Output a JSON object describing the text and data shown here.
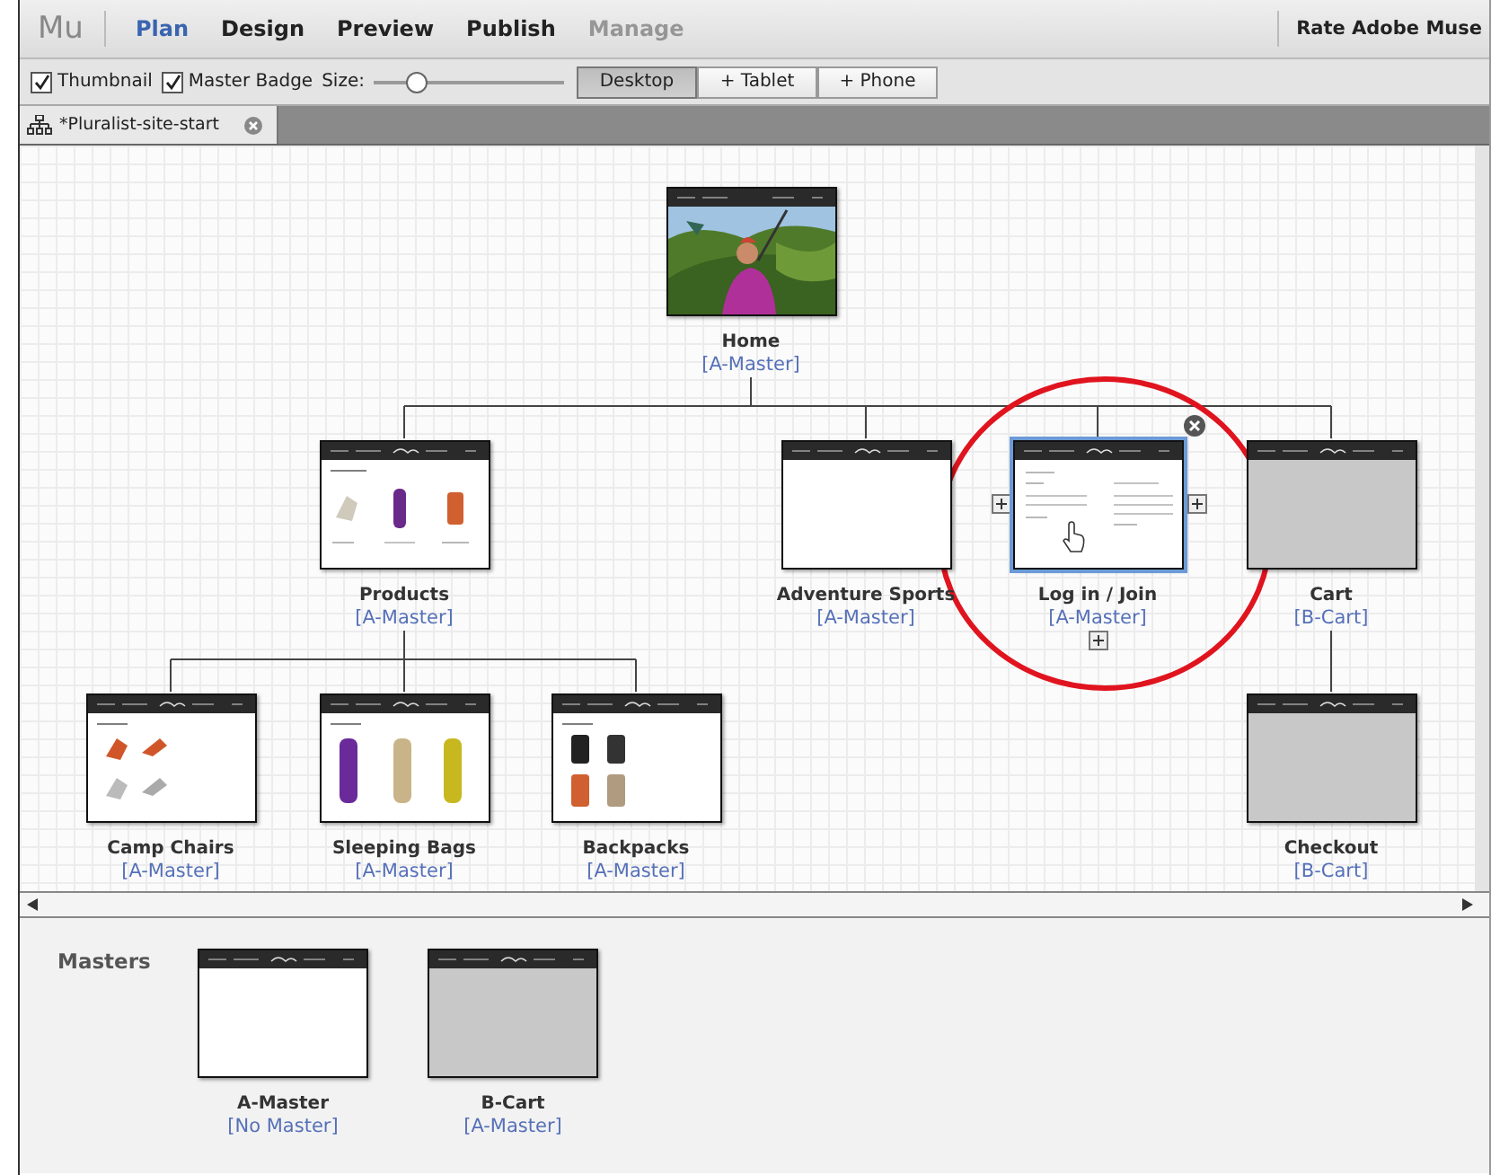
{
  "menubar": {
    "logo": "Mu",
    "items": [
      {
        "label": "Plan",
        "selected": true,
        "disabled": false
      },
      {
        "label": "Design",
        "selected": false,
        "disabled": false
      },
      {
        "label": "Preview",
        "selected": false,
        "disabled": false
      },
      {
        "label": "Publish",
        "selected": false,
        "disabled": false
      },
      {
        "label": "Manage",
        "selected": false,
        "disabled": true
      }
    ],
    "rate_link": "Rate Adobe Muse"
  },
  "toolbar": {
    "checkboxes": [
      {
        "label": "Thumbnail",
        "checked": true
      },
      {
        "label": "Master Badge",
        "checked": true
      }
    ],
    "size_label": "Size:",
    "size_slider": {
      "level": 0.23
    },
    "layouts": [
      {
        "label": "Desktop",
        "selected": true
      },
      {
        "label": "+ Tablet",
        "selected": false
      },
      {
        "label": "+ Phone",
        "selected": false
      }
    ]
  },
  "document_tab": {
    "title": "*Pluralist-site-start"
  },
  "sitemap": {
    "pages": [
      {
        "name": "Home",
        "master": "[A-Master]",
        "selected": false,
        "children": [
          {
            "name": "Products",
            "master": "[A-Master]",
            "kind": "products",
            "selected": false,
            "children": [
              {
                "name": "Camp Chairs",
                "master": "[A-Master]",
                "kind": "chairs",
                "selected": false
              },
              {
                "name": "Sleeping Bags",
                "master": "[A-Master]",
                "kind": "bags",
                "selected": false
              },
              {
                "name": "Backpacks",
                "master": "[A-Master]",
                "kind": "packs",
                "selected": false
              }
            ]
          },
          {
            "name": "Adventure Sports",
            "master": "[A-Master]",
            "kind": "blank",
            "selected": false
          },
          {
            "name": "Log in / Join",
            "master": "[A-Master]",
            "kind": "login",
            "selected": true
          },
          {
            "name": "Cart",
            "master": "[B-Cart]",
            "kind": "grey",
            "selected": false,
            "children": [
              {
                "name": "Checkout",
                "master": "[B-Cart]",
                "kind": "grey",
                "selected": false
              }
            ]
          }
        ]
      }
    ]
  },
  "masters": {
    "title": "Masters",
    "items": [
      {
        "name": "A-Master",
        "master": "[No Master]",
        "kind": "blank"
      },
      {
        "name": "B-Cart",
        "master": "[A-Master]",
        "kind": "grey"
      }
    ]
  }
}
